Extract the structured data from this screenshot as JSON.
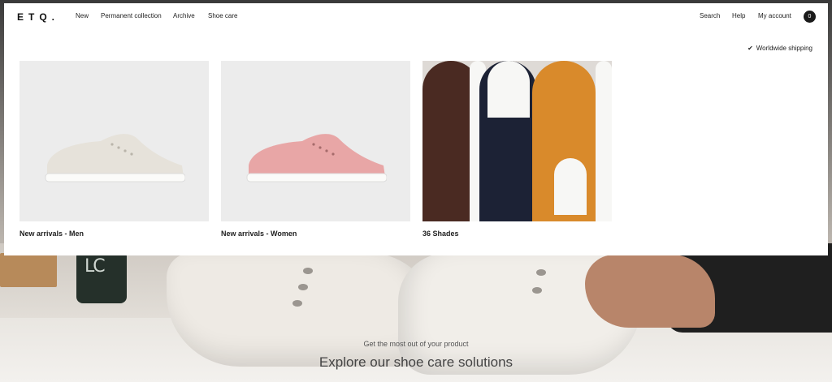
{
  "header": {
    "logo": "ETQ.",
    "nav": [
      "New",
      "Permanent collection",
      "Archive",
      "Shoe care"
    ],
    "utility": [
      "Search",
      "Help",
      "My account"
    ],
    "cart_count": "0"
  },
  "shipping": {
    "label": "Worldwide shipping",
    "icon": "check-icon"
  },
  "menu_cards": [
    {
      "caption": "New arrivals - Men",
      "image": "white-sneaker-image"
    },
    {
      "caption": "New arrivals - Women",
      "image": "pink-sneaker-image"
    },
    {
      "caption": "36 Shades",
      "image": "three-sneakers-image"
    }
  ],
  "hero": {
    "kicker": "Get the most out of your product",
    "cta": "Explore our shoe care solutions"
  },
  "colors": {
    "panel_bg": "#ffffff",
    "card_bg": "#ececec",
    "text": "#222222",
    "cart_badge": "#1a1a1a",
    "shade_brown": "#4a2a22",
    "shade_navy": "#1c2235",
    "shade_ochre": "#d98a2b",
    "pink": "#e8a6a6"
  }
}
